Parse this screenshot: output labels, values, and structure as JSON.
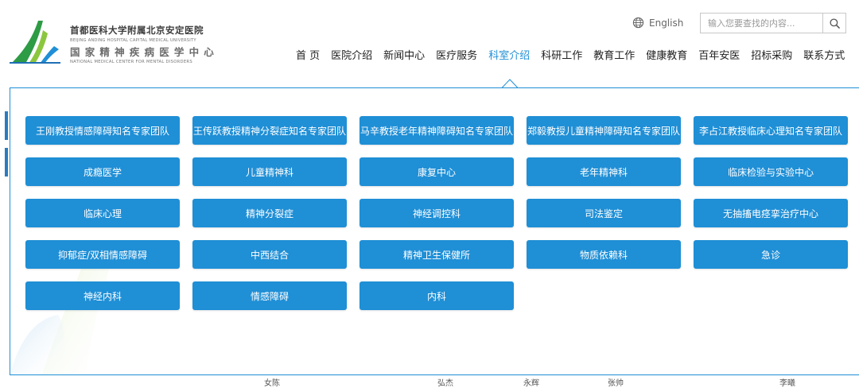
{
  "logo": {
    "cn_line1": "首都医科大学附属北京安定医院",
    "en_line1": "BEIJING ANDING HOSPITAL CAPITAL MEDICAL UNIVERSITY",
    "cn_line2": "国家精神疾病医学中心",
    "en_line2": "NATIONAL MEDICAL CENTER FOR MENTAL DISORDERS"
  },
  "header": {
    "language_label": "English",
    "search_placeholder": "输入您要查找的内容..."
  },
  "nav": {
    "items": [
      {
        "label": "首 页"
      },
      {
        "label": "医院介绍"
      },
      {
        "label": "新闻中心"
      },
      {
        "label": "医疗服务"
      },
      {
        "label": "科室介绍",
        "active": true
      },
      {
        "label": "科研工作"
      },
      {
        "label": "教育工作"
      },
      {
        "label": "健康教育"
      },
      {
        "label": "百年安医"
      },
      {
        "label": "招标采购"
      },
      {
        "label": "联系方式"
      }
    ]
  },
  "departments": [
    "王刚教授情感障碍知名专家团队",
    "王传跃教授精神分裂症知名专家团队",
    "马辛教授老年精神障碍知名专家团队",
    "郑毅教授儿童精神障碍知名专家团队",
    "李占江教授临床心理知名专家团队",
    "成瘾医学",
    "儿童精神科",
    "康复中心",
    "老年精神科",
    "临床检验与实验中心",
    "临床心理",
    "精神分裂症",
    "神经调控科",
    "司法鉴定",
    "无抽搐电痉挛治疗中心",
    "抑郁症/双相情感障碍",
    "中西结合",
    "精神卫生保健所",
    "物质依赖科",
    "急诊",
    "神经内科",
    "情感障碍",
    "内科"
  ],
  "background_row": {
    "cells": [
      "女陈",
      "弘杰",
      "永辉",
      "张帅",
      "李曦"
    ]
  },
  "colors": {
    "accent": "#1f8fd6",
    "button_text": "#ffffff",
    "nav_text": "#222222"
  },
  "icons": {
    "language": "globe-icon",
    "search": "search-icon",
    "caret": "caret-up-icon"
  }
}
